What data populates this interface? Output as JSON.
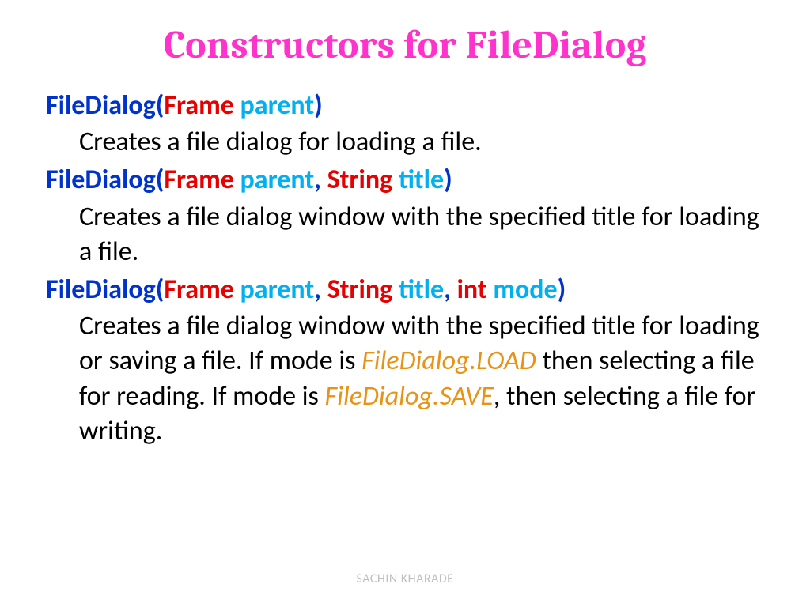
{
  "title": "Constructors for FileDialog",
  "constructors": [
    {
      "name": "FileDialog(",
      "p1type": "Frame ",
      "p1name": "parent",
      "close": ")",
      "hasP2": false,
      "hasP3": false,
      "sep1": "",
      "p2type": "",
      "p2name": "",
      "sep2": "",
      "p3type": "",
      "p3name": "",
      "desc_pre": "Creates a file dialog for loading a file.",
      "mode1": "",
      "desc_mid": "",
      "mode2": "",
      "desc_post": ""
    },
    {
      "name": "FileDialog(",
      "p1type": "Frame ",
      "p1name": "parent",
      "sep1": ", ",
      "p2type": "String ",
      "p2name": "title",
      "close": ")",
      "hasP2": true,
      "hasP3": false,
      "sep2": "",
      "p3type": "",
      "p3name": "",
      "desc_pre": "Creates a file dialog window with the specified title for loading a file.",
      "mode1": "",
      "desc_mid": "",
      "mode2": "",
      "desc_post": ""
    },
    {
      "name": "FileDialog(",
      "p1type": "Frame ",
      "p1name": "parent",
      "sep1": ", ",
      "p2type": "String ",
      "p2name": "title",
      "sep2": ", ",
      "p3type": "int ",
      "p3name": "mode",
      "close": ")",
      "hasP2": true,
      "hasP3": true,
      "desc_pre": "Creates a file dialog window with the specified title for loading or saving a file. If mode is ",
      "mode1": "FileDialog.LOAD",
      "desc_mid": " then selecting a file for reading. If mode is ",
      "mode2": "FileDialog.SAVE",
      "desc_post": ", then selecting a file for writing."
    }
  ],
  "footer": "SACHIN KHARADE"
}
